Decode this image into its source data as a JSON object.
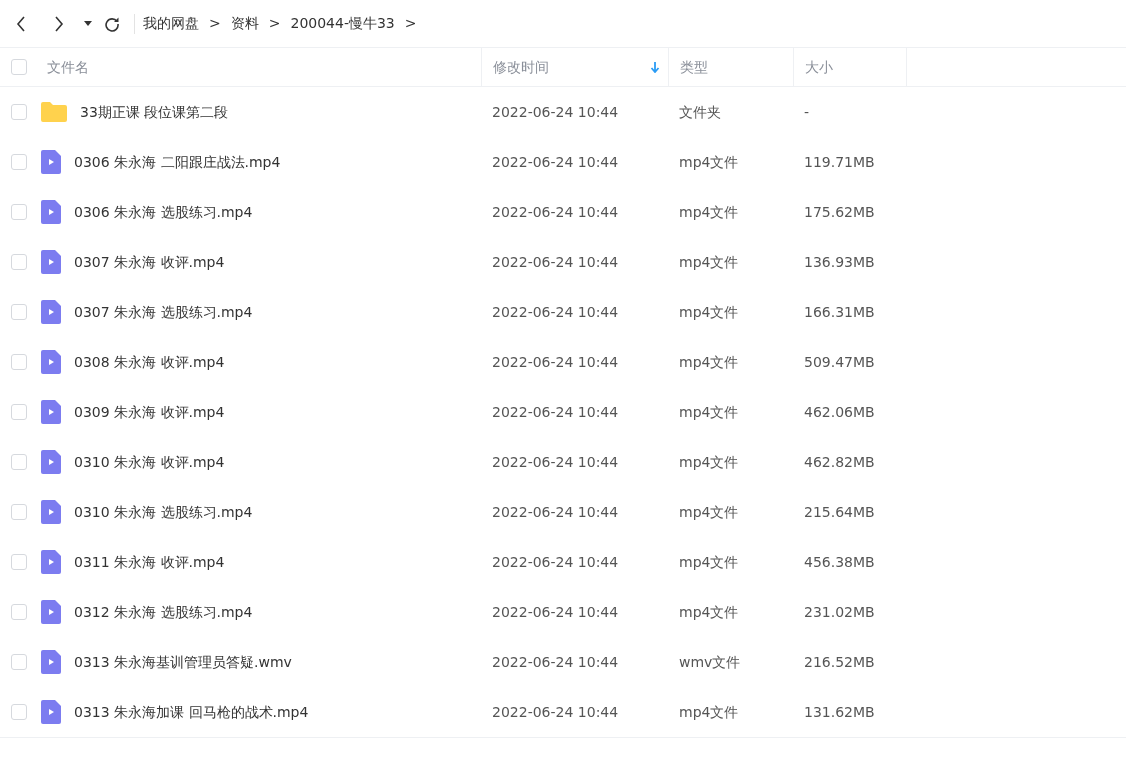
{
  "toolbar": {
    "breadcrumb": [
      {
        "label": "我的网盘"
      },
      {
        "label": "资料"
      },
      {
        "label": "200044-慢牛33"
      }
    ],
    "separator": ">"
  },
  "table": {
    "select_all": {
      "checked": false
    },
    "columns": [
      {
        "label": "文件名",
        "sorted": false
      },
      {
        "label": "修改时间",
        "sorted": true
      },
      {
        "label": "类型",
        "sorted": false
      },
      {
        "label": "大小",
        "sorted": false
      }
    ],
    "rows": [
      {
        "kind": "folder",
        "checked": false,
        "name": "33期正课 段位课第二段",
        "modified": "2022-06-24 10:44",
        "type": "文件夹",
        "size": "-"
      },
      {
        "kind": "video",
        "checked": false,
        "name": "0306 朱永海 二阳跟庄战法.mp4",
        "modified": "2022-06-24 10:44",
        "type": "mp4文件",
        "size": "119.71MB"
      },
      {
        "kind": "video",
        "checked": false,
        "name": "0306 朱永海 选股练习.mp4",
        "modified": "2022-06-24 10:44",
        "type": "mp4文件",
        "size": "175.62MB"
      },
      {
        "kind": "video",
        "checked": false,
        "name": "0307 朱永海 收评.mp4",
        "modified": "2022-06-24 10:44",
        "type": "mp4文件",
        "size": "136.93MB"
      },
      {
        "kind": "video",
        "checked": false,
        "name": "0307 朱永海 选股练习.mp4",
        "modified": "2022-06-24 10:44",
        "type": "mp4文件",
        "size": "166.31MB"
      },
      {
        "kind": "video",
        "checked": false,
        "name": "0308 朱永海 收评.mp4",
        "modified": "2022-06-24 10:44",
        "type": "mp4文件",
        "size": "509.47MB"
      },
      {
        "kind": "video",
        "checked": false,
        "name": "0309 朱永海 收评.mp4",
        "modified": "2022-06-24 10:44",
        "type": "mp4文件",
        "size": "462.06MB"
      },
      {
        "kind": "video",
        "checked": false,
        "name": "0310 朱永海 收评.mp4",
        "modified": "2022-06-24 10:44",
        "type": "mp4文件",
        "size": "462.82MB"
      },
      {
        "kind": "video",
        "checked": false,
        "name": "0310 朱永海 选股练习.mp4",
        "modified": "2022-06-24 10:44",
        "type": "mp4文件",
        "size": "215.64MB"
      },
      {
        "kind": "video",
        "checked": false,
        "name": "0311 朱永海 收评.mp4",
        "modified": "2022-06-24 10:44",
        "type": "mp4文件",
        "size": "456.38MB"
      },
      {
        "kind": "video",
        "checked": false,
        "name": "0312 朱永海 选股练习.mp4",
        "modified": "2022-06-24 10:44",
        "type": "mp4文件",
        "size": "231.02MB"
      },
      {
        "kind": "video",
        "checked": false,
        "name": "0313 朱永海基训管理员答疑.wmv",
        "modified": "2022-06-24 10:44",
        "type": "wmv文件",
        "size": "216.52MB"
      },
      {
        "kind": "video",
        "checked": false,
        "name": "0313 朱永海加课 回马枪的战术.mp4",
        "modified": "2022-06-24 10:44",
        "type": "mp4文件",
        "size": "131.62MB"
      }
    ]
  }
}
